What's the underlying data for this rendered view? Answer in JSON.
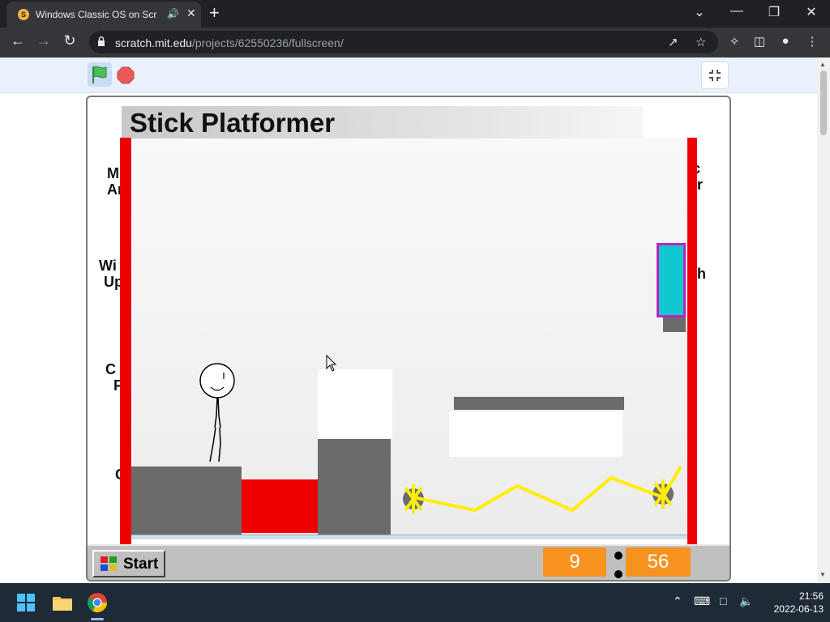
{
  "browser": {
    "tab_title": "Windows Classic OS on Scratch",
    "tab_audio_icon": "speaker-icon",
    "url_host": "scratch.mit.edu",
    "url_path": "/projects/62550236/fullscreen/"
  },
  "scratch": {
    "game_title": "Stick Platformer",
    "left_labels": [
      "M\nAr",
      "Wi\nUp",
      "C\nF",
      "C"
    ],
    "right_labels": [
      "c\ner",
      "sh"
    ],
    "start_label": "Start",
    "clock_hours": "9",
    "clock_minutes": "56"
  },
  "os": {
    "time": "21:56",
    "date": "2022-06-13"
  },
  "colors": {
    "accent_orange": "#f7931e",
    "wall_red": "#ee0000",
    "platform_gray": "#6b6b6b",
    "laser_yellow": "#ffee00",
    "door_cyan": "#12c8d0",
    "door_border": "#c020c0"
  }
}
